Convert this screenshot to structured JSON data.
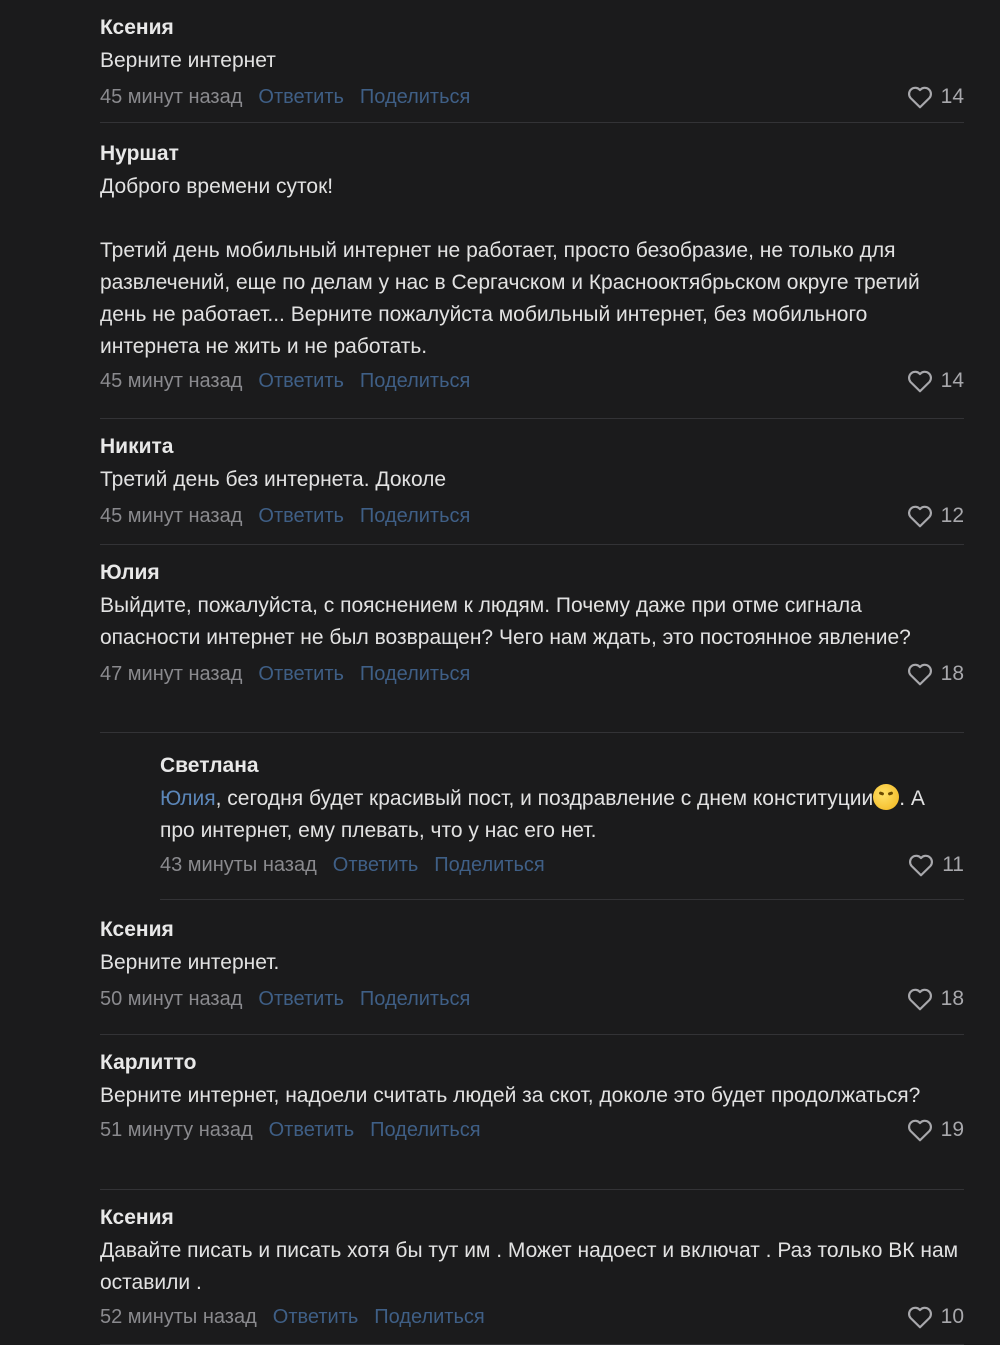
{
  "comments": [
    {
      "author": "Ксения",
      "text": "Верните интернет",
      "time": "45 минут назад",
      "reply": "Ответить",
      "share": "Поделиться",
      "likes": "14"
    },
    {
      "author": "Нуршат",
      "text": "Доброго времени суток!\n\nТретий день мобильный интернет не работает, просто безобразие, не только для развлечений, еще по делам у нас в Сергачском и Краснооктябрьском округе третий день не работает... Верните пожалуйста мобильный интернет, без мобильного интернета не жить и не работать.",
      "time": "45 минут назад",
      "reply": "Ответить",
      "share": "Поделиться",
      "likes": "14"
    },
    {
      "author": "Никита",
      "text": "Третий день без интернета. Доколе",
      "time": "45 минут назад",
      "reply": "Ответить",
      "share": "Поделиться",
      "likes": "12"
    },
    {
      "author": "Юлия",
      "text": "Выйдите, пожалуйста, с пояснением к людям. Почему даже при отме сигнала опасности интернет не был возвращен? Чего нам ждать, это постоянное явление?",
      "time": "47 минут назад",
      "reply": "Ответить",
      "share": "Поделиться",
      "likes": "18"
    },
    {
      "author": "Светлана",
      "mention": "Юлия",
      "text_before_emoji": ", сегодня будет красивый пост, и поздравление с днем конституции",
      "emoji_icon": "winking-face-emoji",
      "text_after_emoji": ". А про интернет, ему плевать, что у нас его нет.",
      "time": "43 минуты назад",
      "reply": "Ответить",
      "share": "Поделиться",
      "likes": "11"
    },
    {
      "author": "Ксения",
      "text": "Верните интернет.",
      "time": "50 минут назад",
      "reply": "Ответить",
      "share": "Поделиться",
      "likes": "18"
    },
    {
      "author": "Карлитто",
      "text": "Верните интернет, надоели считать людей за скот, доколе это будет продолжаться?",
      "time": "51 минуту назад",
      "reply": "Ответить",
      "share": "Поделиться",
      "likes": "19"
    },
    {
      "author": "Ксения",
      "text": "Давайте писать и писать хотя бы тут им . Может надоест и включат . Раз только ВК нам оставили .",
      "time": "52 минуты назад",
      "reply": "Ответить",
      "share": "Поделиться",
      "likes": "10"
    }
  ],
  "icons": {
    "like": "heart-icon"
  },
  "colors": {
    "background": "#1b1b1c",
    "link": "#3f5f86",
    "mention": "#5b86b8",
    "muted": "#8a8a8e"
  }
}
